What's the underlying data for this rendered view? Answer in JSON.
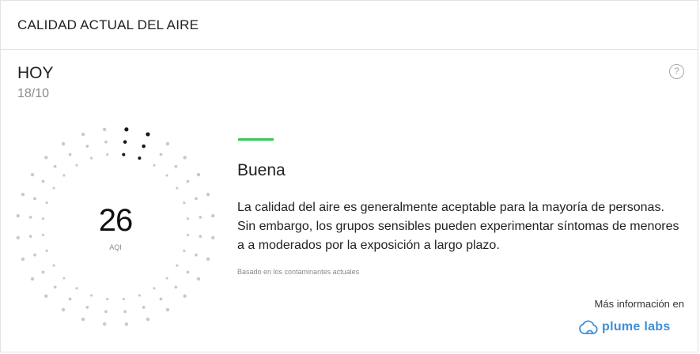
{
  "card": {
    "title": "CALIDAD ACTUAL DEL AIRE",
    "day": "HOY",
    "date": "18/10",
    "help_label": "?"
  },
  "aqi": {
    "value": "26",
    "unit": "AQI",
    "scale_max": 300,
    "colors": {
      "filled": "#1a1a1a",
      "empty": "#c9c9c9"
    }
  },
  "status": {
    "label": "Buena",
    "color": "#35c759",
    "description": "La calidad del aire es generalmente aceptable para la mayoría de personas. Sin embargo, los grupos sensibles pueden experimentar síntomas de menores a a moderados por la exposición a largo plazo.",
    "basis": "Basado en los contaminantes actuales"
  },
  "footer": {
    "more_info": "Más información en",
    "brand_name": "plume labs",
    "brand_icon": "cloud-icon",
    "brand_color": "#3c8fd6"
  }
}
